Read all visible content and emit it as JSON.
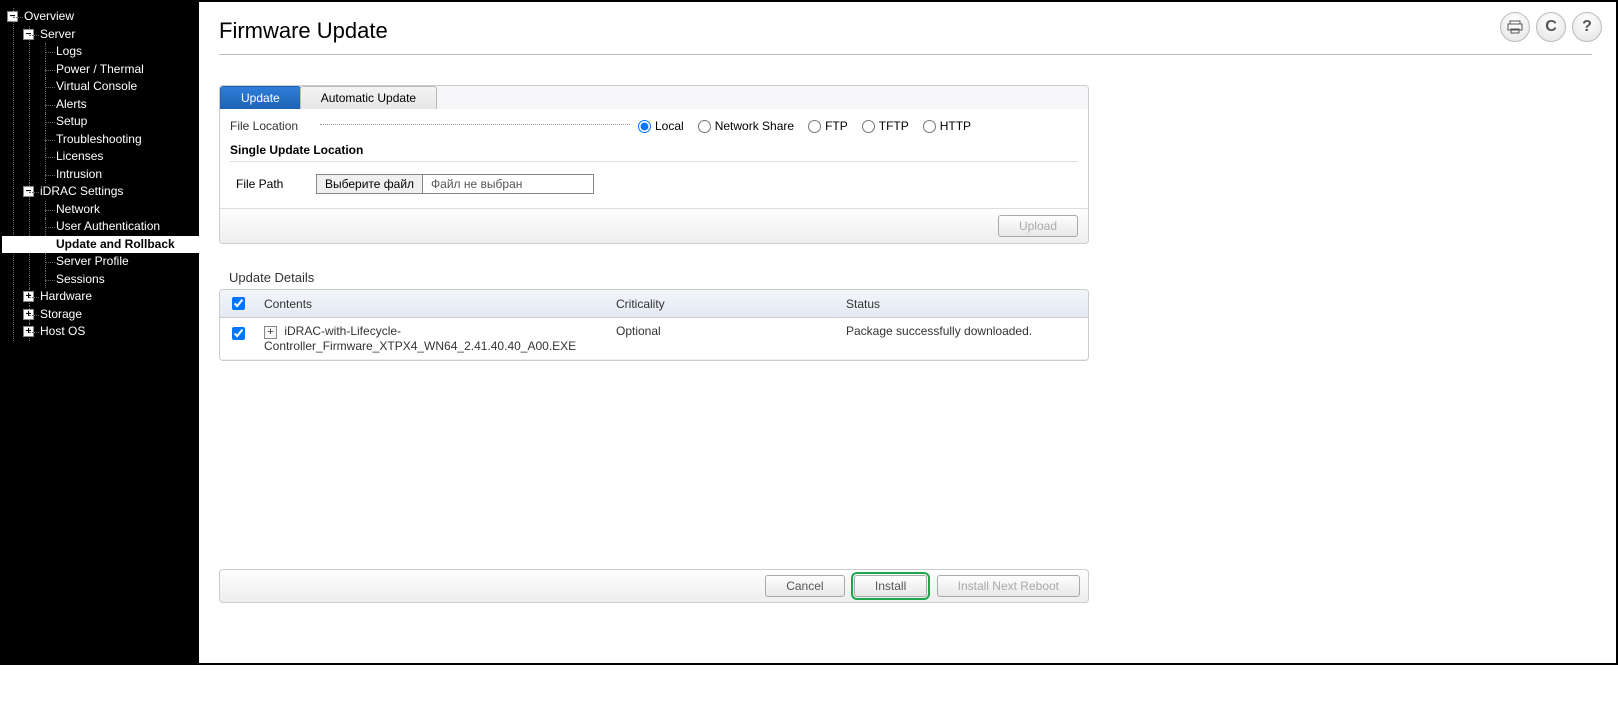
{
  "page": {
    "title": "Firmware Update"
  },
  "topButtons": {
    "print": "print-icon",
    "refresh": "refresh-icon",
    "help": "help-icon"
  },
  "nav": {
    "overview": "Overview",
    "server": "Server",
    "server_children": {
      "logs": "Logs",
      "power_thermal": "Power / Thermal",
      "virtual_console": "Virtual Console",
      "alerts": "Alerts",
      "setup": "Setup",
      "troubleshooting": "Troubleshooting",
      "licenses": "Licenses",
      "intrusion": "Intrusion"
    },
    "idrac_settings": "iDRAC Settings",
    "idrac_children": {
      "network": "Network",
      "user_auth": "User Authentication",
      "update_rollback": "Update and Rollback",
      "server_profile": "Server Profile",
      "sessions": "Sessions"
    },
    "hardware": "Hardware",
    "storage": "Storage",
    "host_os": "Host OS"
  },
  "tabs": {
    "update": "Update",
    "auto_update": "Automatic Update"
  },
  "form": {
    "file_location_label": "File Location",
    "locations": {
      "local": "Local",
      "network_share": "Network Share",
      "ftp": "FTP",
      "tftp": "TFTP",
      "http": "HTTP",
      "selected": "local"
    },
    "single_update_title": "Single Update Location",
    "file_path_label": "File Path",
    "file_choose_btn": "Выберите файл",
    "file_chosen_text": "Файл не выбран",
    "upload_btn": "Upload"
  },
  "details": {
    "title": "Update Details",
    "columns": {
      "contents": "Contents",
      "criticality": "Criticality",
      "status": "Status"
    },
    "rows": [
      {
        "checked": true,
        "contents": "iDRAC-with-Lifecycle-Controller_Firmware_XTPX4_WN64_2.41.40.40_A00.EXE",
        "criticality": "Optional",
        "status": "Package successfully downloaded."
      }
    ]
  },
  "actions": {
    "cancel": "Cancel",
    "install": "Install",
    "install_next_reboot": "Install Next Reboot"
  }
}
